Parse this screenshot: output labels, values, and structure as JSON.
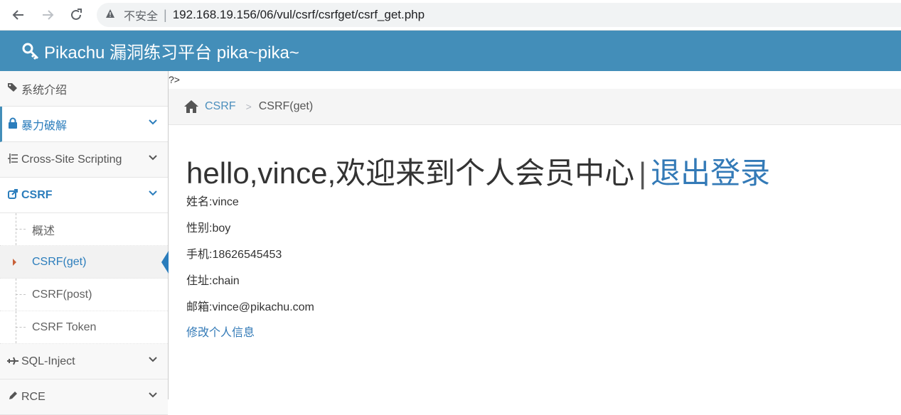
{
  "browser": {
    "insecure_label": "不安全",
    "separator": "|",
    "url": "192.168.19.156/06/vul/csrf/csrfget/csrf_get.php"
  },
  "header": {
    "brand": "Pikachu 漏洞练习平台 pika~pika~"
  },
  "sidebar": {
    "items": [
      {
        "label": "系统介绍"
      },
      {
        "label": "暴力破解"
      },
      {
        "label": "Cross-Site Scripting"
      },
      {
        "label": "CSRF"
      },
      {
        "label": "SQL-Inject"
      },
      {
        "label": "RCE"
      }
    ],
    "csrf_sub": [
      {
        "label": "概述"
      },
      {
        "label": "CSRF(get)"
      },
      {
        "label": "CSRF(post)"
      },
      {
        "label": "CSRF Token"
      }
    ]
  },
  "main": {
    "stray_text": "?>",
    "breadcrumb": {
      "parent": "CSRF",
      "current": "CSRF(get)"
    },
    "greeting": "hello,vince,欢迎来到个人会员中心",
    "pipe": "|",
    "logout": "退出登录",
    "info": {
      "name": "姓名:vince",
      "gender": "性别:boy",
      "phone": "手机:18626545453",
      "address": "住址:chain",
      "email": "邮箱:vince@pikachu.com"
    },
    "edit_link": "修改个人信息"
  },
  "colors": {
    "header_bg": "#438eb9",
    "link": "#337ab7",
    "active": "#2b7dbc"
  }
}
